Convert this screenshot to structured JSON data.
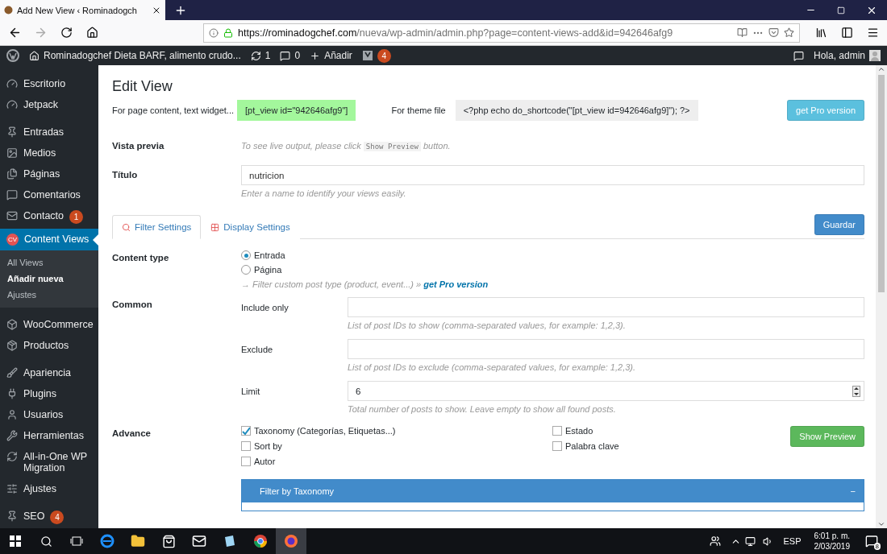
{
  "browser": {
    "tab_title": "Add New View ‹ Rominadogch",
    "url_host": "https://rominadogchef.com",
    "url_path": "/nueva/wp-admin/admin.php?page=content-views-add&id=942646afg9"
  },
  "admin_bar": {
    "site": "Rominadogchef Dieta BARF, alimento crudo...",
    "updates": "1",
    "comments": "0",
    "new": "Añadir",
    "seo_count": "4",
    "greeting": "Hola, admin"
  },
  "sidebar": {
    "items": [
      {
        "label": "Escritorio",
        "selected": false
      },
      {
        "label": "Jetpack",
        "selected": false
      },
      {
        "label": "Entradas",
        "selected": false
      },
      {
        "label": "Medios",
        "selected": false
      },
      {
        "label": "Páginas",
        "selected": false
      },
      {
        "label": "Comentarios",
        "selected": false
      },
      {
        "label": "Contacto",
        "badge": "1",
        "selected": false
      },
      {
        "label": "Content Views",
        "logo": "CV",
        "selected": true,
        "children": [
          {
            "label": "All Views",
            "selected": false
          },
          {
            "label": "Añadir nueva",
            "selected": true
          },
          {
            "label": "Ajustes",
            "selected": false
          }
        ]
      },
      {
        "label": "WooCommerce",
        "selected": false
      },
      {
        "label": "Productos",
        "selected": false
      },
      {
        "label": "Apariencia",
        "selected": false
      },
      {
        "label": "Plugins",
        "selected": false
      },
      {
        "label": "Usuarios",
        "selected": false
      },
      {
        "label": "Herramientas",
        "selected": false
      },
      {
        "label": "All-in-One WP Migration",
        "selected": false
      },
      {
        "label": "Ajustes",
        "selected": false
      },
      {
        "label": "SEO",
        "badge": "4",
        "selected": false
      }
    ]
  },
  "page": {
    "title": "Edit View",
    "shortcode_label": "For page content, text widget...",
    "shortcode": "[pt_view id=\"942646afg9\"]",
    "theme_label": "For theme file",
    "theme_code": "<?php echo do_shortcode(\"[pt_view id=942646afg9]\"); ?>",
    "pro_button": "get Pro version"
  },
  "preview": {
    "label": "Vista previa",
    "hint_before": "To see live output, please click",
    "hint_code": "Show Preview",
    "hint_after": "button."
  },
  "title_field": {
    "label": "Título",
    "value": "nutricion",
    "hint": "Enter a name to identify your views easily."
  },
  "tabs": [
    {
      "label": "Filter Settings",
      "selected": true
    },
    {
      "label": "Display Settings",
      "selected": false
    }
  ],
  "save_button": "Guardar",
  "content_type": {
    "label": "Content type",
    "options": [
      {
        "label": "Entrada",
        "selected": true
      },
      {
        "label": "Página",
        "selected": false
      }
    ],
    "note": "→ Filter custom post type (product, event...) »",
    "link": "get Pro version"
  },
  "common": {
    "label": "Common",
    "fields": [
      {
        "label": "Include only",
        "kind": "text",
        "hint": "List of post IDs to show (comma-separated values, for example: 1,2,3)."
      },
      {
        "label": "Exclude",
        "kind": "text",
        "hint": "List of post IDs to exclude (comma-separated values, for example: 1,2,3)."
      },
      {
        "label": "Limit",
        "kind": "number",
        "value": "6",
        "hint": "Total number of posts to show. Leave empty to show all found posts."
      }
    ]
  },
  "advance": {
    "label": "Advance",
    "columns": [
      [
        {
          "label": "Taxonomy (Categorías, Etiquetas...)",
          "checked": true
        },
        {
          "label": "Sort by",
          "checked": false
        },
        {
          "label": "Autor",
          "checked": false
        }
      ],
      [
        {
          "label": "Estado",
          "checked": false
        },
        {
          "label": "Palabra clave",
          "checked": false
        }
      ]
    ],
    "preview_button": "Show Preview",
    "panel": {
      "title": "Filter by Taxonomy",
      "toggle": "−"
    }
  },
  "taskbar": {
    "language": "ESP",
    "time": "6:01 p. m.",
    "date": "2/03/2019",
    "notifications": "8"
  }
}
